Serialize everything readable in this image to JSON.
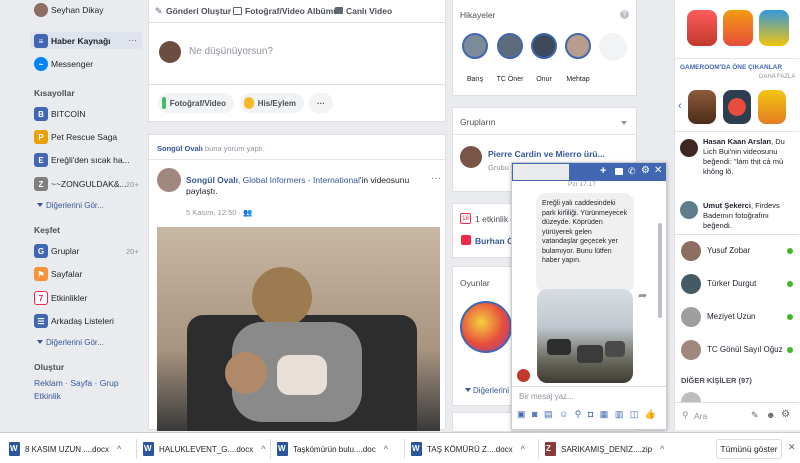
{
  "user": {
    "name": "Seyhan Dikay"
  },
  "leftnav": {
    "main": [
      {
        "label": "Haber Kaynağı",
        "icon": "news-feed-icon",
        "color": "#4267b2"
      },
      {
        "label": "Messenger",
        "icon": "messenger-icon",
        "color": "#0084ff"
      }
    ],
    "shortcuts_title": "Kısayollar",
    "shortcuts": [
      {
        "label": "BITCOİN",
        "color": "#4267b2"
      },
      {
        "label": "Pet Rescue Saga",
        "color": "#e8a200"
      },
      {
        "label": "Ereğli'den sıcak ha...",
        "color": "#4267b2"
      },
      {
        "label": "~~ZONGULDAK&...",
        "color": "#7f7f7f",
        "count": "20+"
      }
    ],
    "shortcuts_more": "Diğerlerini Gör...",
    "explore_title": "Keşfet",
    "explore": [
      {
        "label": "Gruplar",
        "color": "#4267b2",
        "count": "20+"
      },
      {
        "label": "Sayfalar",
        "color": "#f7923a"
      },
      {
        "label": "Etkinlikler",
        "color": "#f02849"
      },
      {
        "label": "Arkadaş Listeleri",
        "color": "#4267b2"
      }
    ],
    "explore_more": "Diğerlerini Gör...",
    "create_title": "Oluştur",
    "create_links": [
      "Reklam",
      "Sayfa",
      "Grup",
      "Etkinlik"
    ]
  },
  "composer": {
    "tabs": [
      "Gönderi Oluştur",
      "Fotoğraf/Video Albümü",
      "Canlı Video"
    ],
    "placeholder": "Ne düşünüyorsun?",
    "actions": [
      "Fotoğraf/Video",
      "His/Eylem"
    ]
  },
  "post": {
    "activity_name": "Songül Ovalı",
    "activity_text": " buna yorum yaptı.",
    "author": "Songül Ovalı",
    "middle": ", Global Informers - International",
    "tail": "'in videosunu paylaştı.",
    "time": "5 Kasım, 12:50 · "
  },
  "stories": {
    "title": "Hikayeler",
    "items": [
      {
        "name": "Barış"
      },
      {
        "name": "TC Öner"
      },
      {
        "name": "Onur"
      },
      {
        "name": "Mehtap"
      }
    ]
  },
  "groups": {
    "title": "Grupların",
    "group_name": "Pierre Cardin ve Mierro ürü...",
    "group_sub": "Grubu"
  },
  "events": {
    "title": "1 etkinlik d",
    "item": "Burhan Ön"
  },
  "games": {
    "title": "Oyunlar",
    "more": "Diğerlerini G"
  },
  "chat": {
    "time": "Pzr 17:17",
    "message": "Ereğli yalı caddesindeki park kirliliği. Yürünmeyecek düzeyde. Köprüden yürüyerek gelen vatandaşlar geçecek yer bulamıyor. Bunu lütfen haber yapın.",
    "input_placeholder": "Bir mesaj yaz..."
  },
  "rightside": {
    "gameroom_title": "GAMEROOM'DA ÖNE ÇIKANLAR",
    "gameroom_more": "DAHA FAZLA",
    "ticker": [
      {
        "name": "Hasan Kaan Arslan",
        "text": ", Du Lich Bụi'nin videosunu beğendi: \"làm thịt cả mù không lõ."
      },
      {
        "name": "Umut Şekerci",
        "text": ", Firdevs Bademın fotoğrafını beğendi."
      }
    ],
    "contacts": [
      {
        "name": "Yusuf Zobar",
        "online": true
      },
      {
        "name": "Türker Durgut",
        "online": true
      },
      {
        "name": "Meziyet Uzun",
        "online": true
      },
      {
        "name": "TC Gönül Sayıl Oğuz",
        "online": true
      }
    ],
    "others_title": "DİĞER KİŞİLER (97)",
    "search_placeholder": "Ara"
  },
  "downloads": {
    "items": [
      {
        "name": "8 KASIM UZUN ....docx",
        "type": "word"
      },
      {
        "name": "HALUKLEVENT_G....docx",
        "type": "word"
      },
      {
        "name": "Taşkömürün bulu....doc",
        "type": "word"
      },
      {
        "name": "TAŞ KÖMÜRÜ Z....docx",
        "type": "word"
      },
      {
        "name": "SARIKAMIŞ_DENİZ....zip",
        "type": "zip"
      }
    ],
    "show_all": "Tümünü göster"
  },
  "colors": {
    "brand": "#4267b2",
    "link": "#365899",
    "online": "#42b72a",
    "bg": "#e9ebee"
  }
}
